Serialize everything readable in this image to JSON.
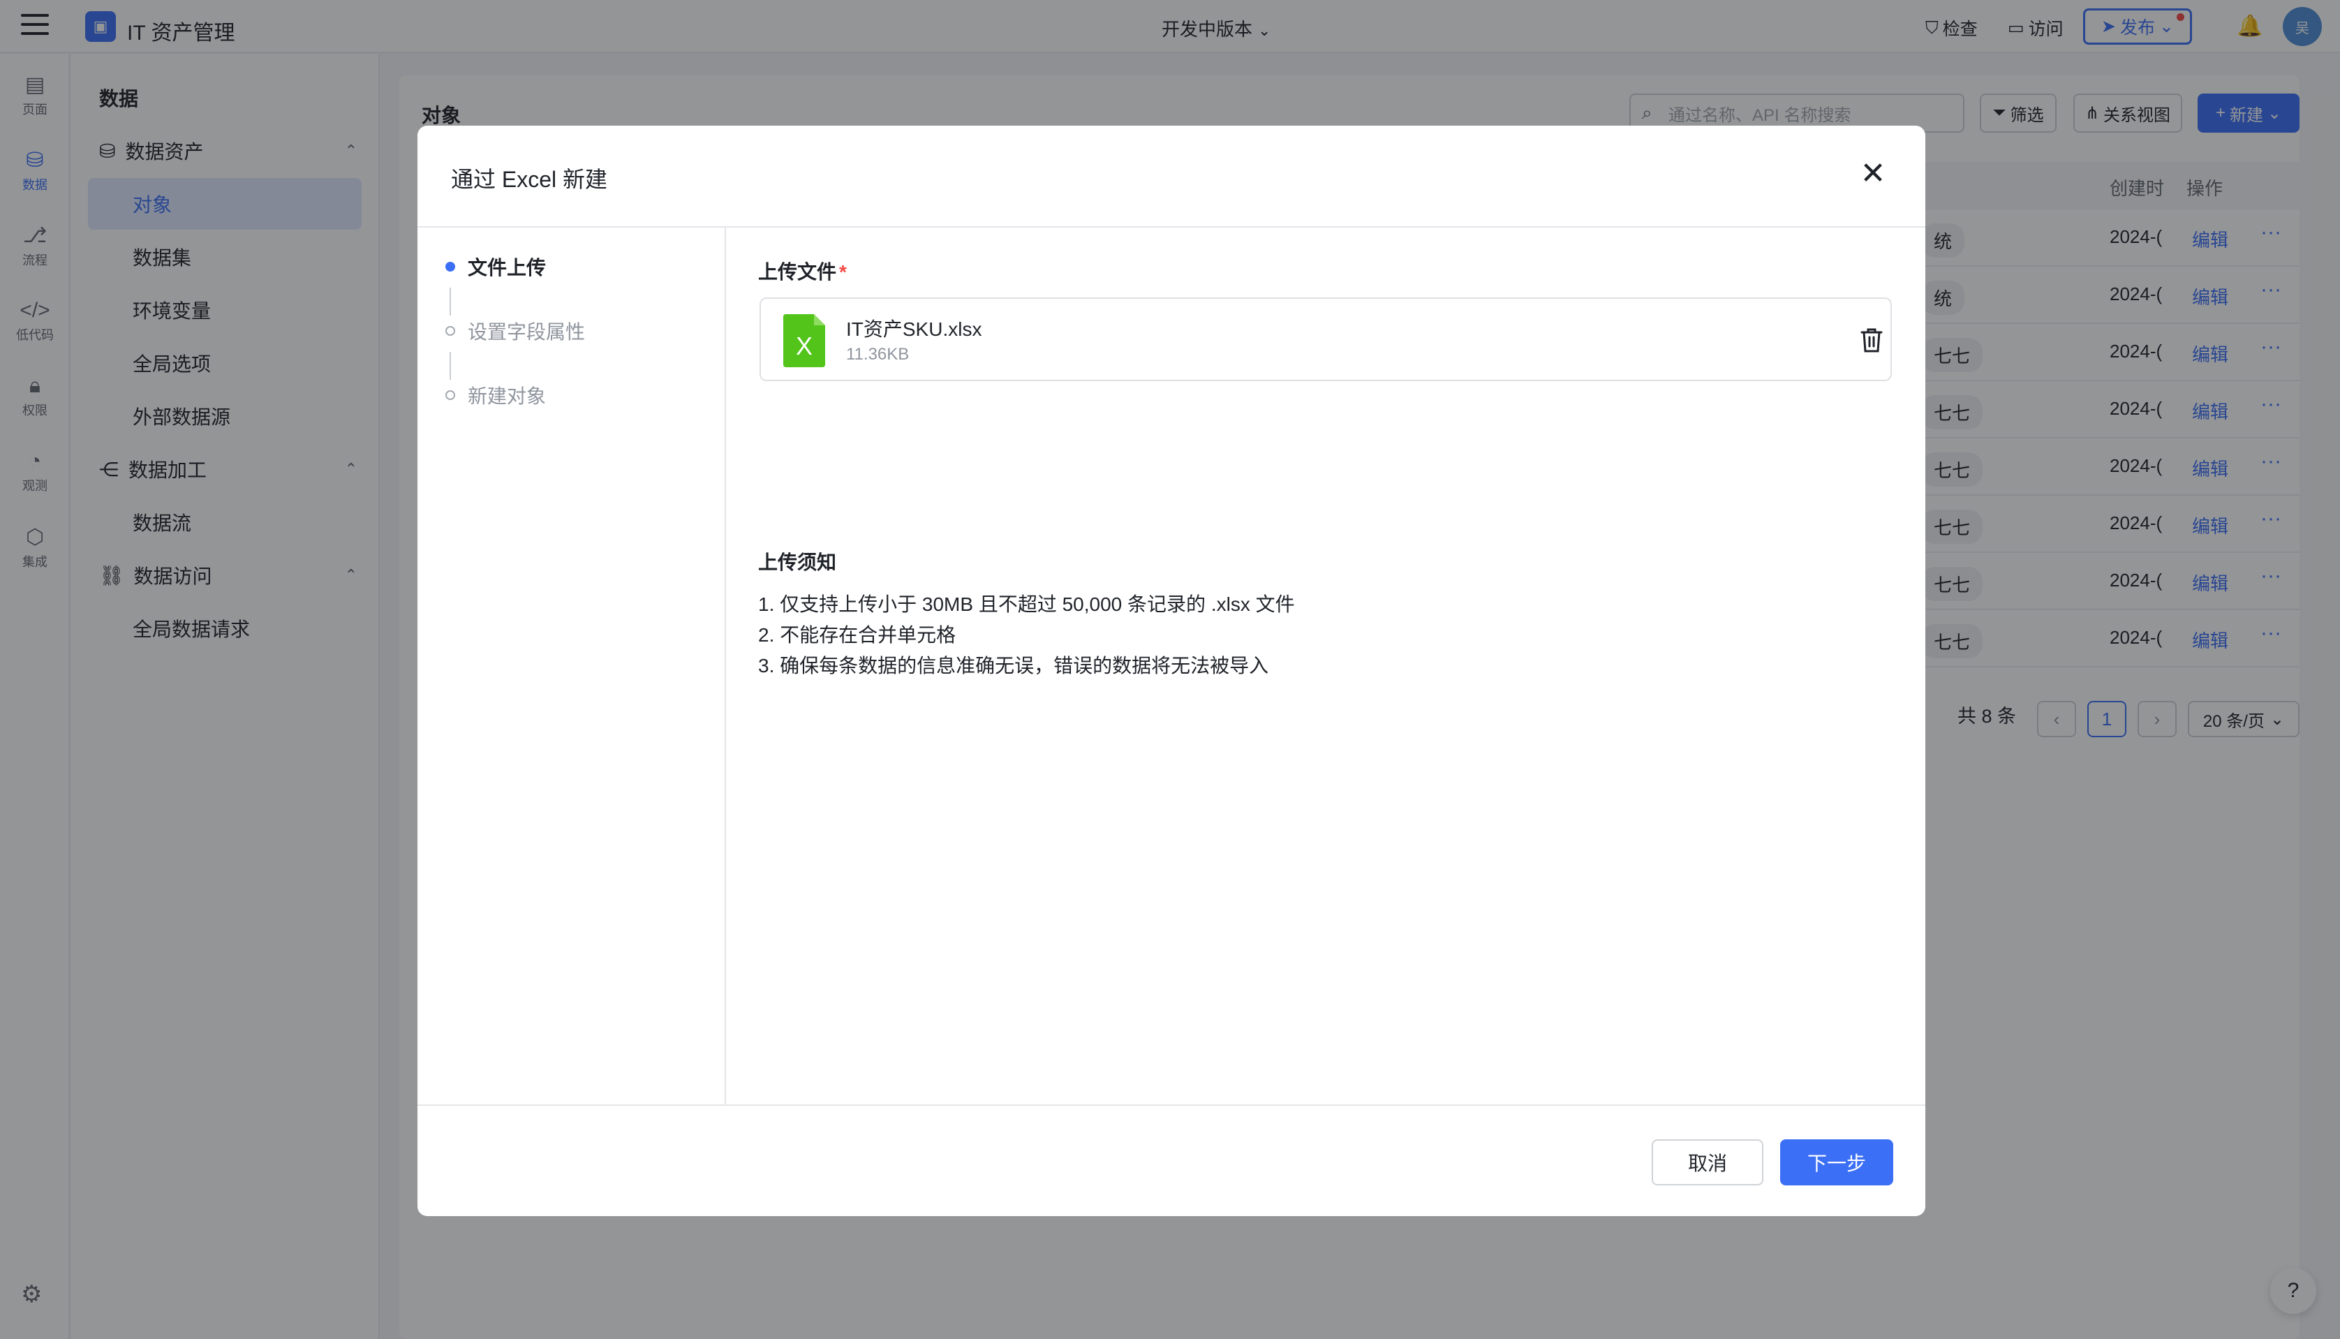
{
  "app": {
    "title": "IT 资产管理",
    "version_label": "开发中版本",
    "check_label": "检查",
    "visit_label": "访问",
    "publish_label": "发布",
    "avatar_text": "吴"
  },
  "rail": {
    "items": [
      {
        "label": "页面",
        "icon": "page-icon"
      },
      {
        "label": "数据",
        "icon": "database-icon"
      },
      {
        "label": "流程",
        "icon": "workflow-icon"
      },
      {
        "label": "低代码",
        "icon": "code-icon"
      },
      {
        "label": "权限",
        "icon": "lock-icon"
      },
      {
        "label": "观测",
        "icon": "monitor-icon"
      },
      {
        "label": "集成",
        "icon": "cube-icon"
      }
    ]
  },
  "subnav": {
    "title": "数据",
    "groups": [
      {
        "label": "数据资产",
        "items": [
          "对象",
          "数据集",
          "环境变量",
          "全局选项",
          "外部数据源"
        ]
      },
      {
        "label": "数据加工",
        "items": [
          "数据流"
        ]
      },
      {
        "label": "数据访问",
        "items": [
          "全局数据请求"
        ]
      }
    ]
  },
  "main": {
    "title": "对象",
    "search_placeholder": "通过名称、API 名称搜索",
    "filter_label": "筛选",
    "relation_view_label": "关系视图",
    "new_label": "新建",
    "columns": [
      "创建时",
      "操作"
    ],
    "rows": [
      {
        "tag": "统",
        "date": "2024-(",
        "edit": "编辑",
        "more": "···"
      },
      {
        "tag": "统",
        "date": "2024-(",
        "edit": "编辑",
        "more": "···"
      },
      {
        "tag": "七七",
        "date": "2024-(",
        "edit": "编辑",
        "more": "···"
      },
      {
        "tag": "七七",
        "date": "2024-(",
        "edit": "编辑",
        "more": "···"
      },
      {
        "tag": "七七",
        "date": "2024-(",
        "edit": "编辑",
        "more": "···"
      },
      {
        "tag": "七七",
        "date": "2024-(",
        "edit": "编辑",
        "more": "···"
      },
      {
        "tag": "七七",
        "date": "2024-(",
        "edit": "编辑",
        "more": "···"
      },
      {
        "tag": "七七",
        "date": "2024-(",
        "edit": "编辑",
        "more": "···"
      }
    ],
    "pager": {
      "total": "共 8 条",
      "current_page": "1",
      "page_size": "20 条/页"
    }
  },
  "modal": {
    "title": "通过 Excel 新建",
    "steps": [
      "文件上传",
      "设置字段属性",
      "新建对象"
    ],
    "upload_label": "上传文件",
    "required_mark": "*",
    "file": {
      "name": "IT资产SKU.xlsx",
      "size": "11.36KB",
      "icon_letter": "X"
    },
    "notice_title": "上传须知",
    "notices": [
      "1. 仅支持上传小于 30MB 且不超过 50,000 条记录的 .xlsx 文件",
      "2. 不能存在合并单元格",
      "3. 确保每条数据的信息准确无误，错误的数据将无法被导入"
    ],
    "cancel_label": "取消",
    "next_label": "下一步"
  },
  "colors": {
    "accent": "#3b6ff5",
    "excel_green": "#52c41a",
    "required": "#f54a45"
  }
}
